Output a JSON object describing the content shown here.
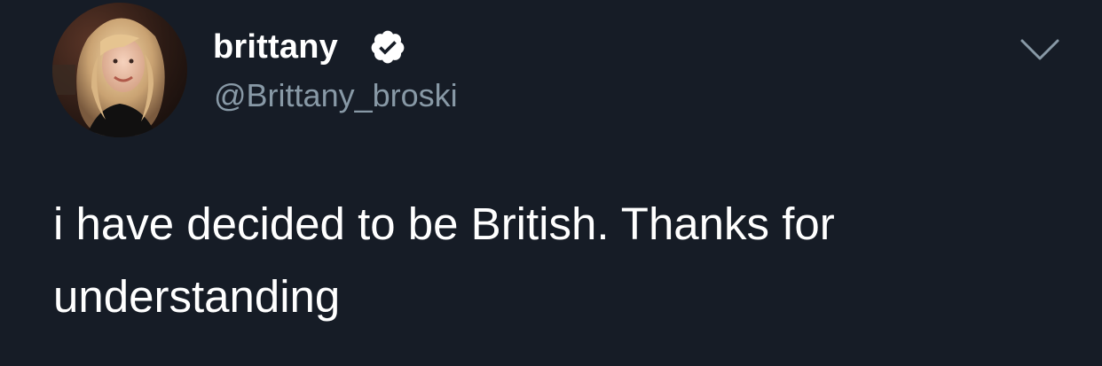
{
  "tweet": {
    "author": {
      "display_name": "brittany",
      "handle": "@Brittany_broski",
      "verified": true,
      "avatar_icon": "profile-photo"
    },
    "text": "i have decided to be British. Thanks for understanding",
    "menu_icon": "chevron-down-icon"
  },
  "colors": {
    "background": "#161c26",
    "primary_text": "#ffffff",
    "secondary_text": "#8899a6",
    "verified_badge": "#ffffff"
  }
}
